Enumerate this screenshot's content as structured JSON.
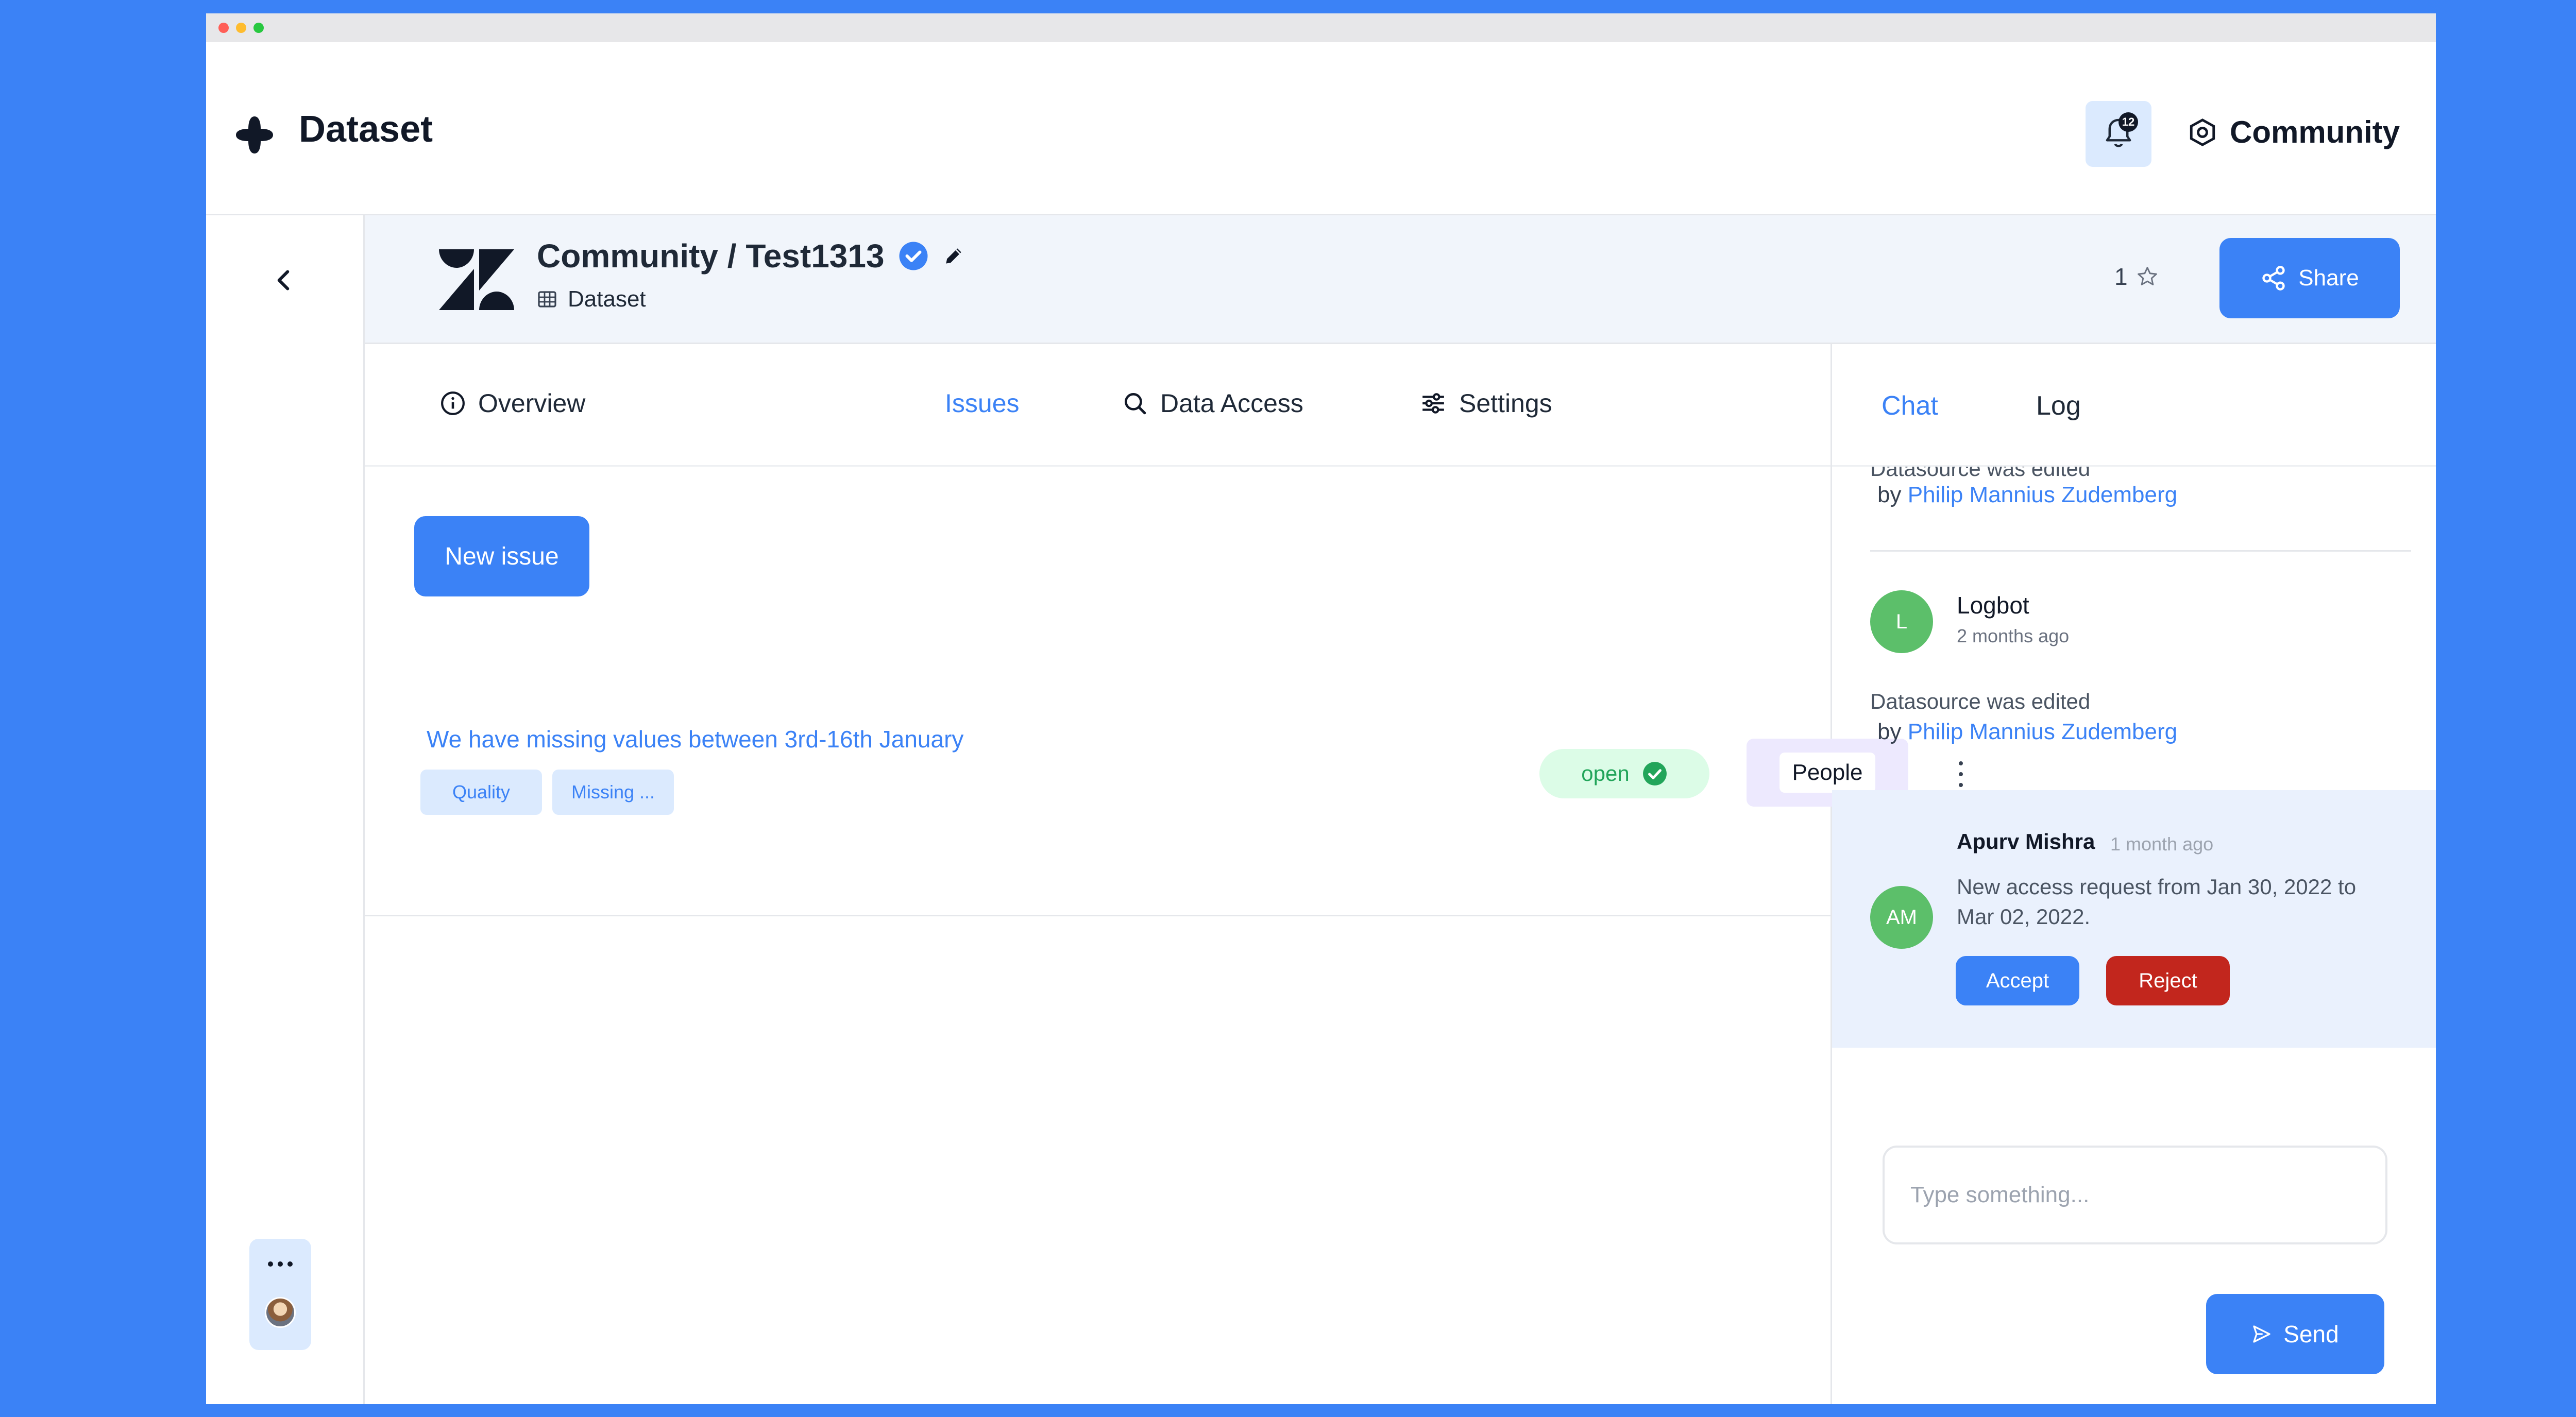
{
  "app": {
    "title": "Dataset",
    "notification_count": "12",
    "workspace": "Community"
  },
  "dataset": {
    "title": "Community / Test1313",
    "type_label": "Dataset",
    "star_count": "1",
    "share_label": "Share"
  },
  "tabs": [
    {
      "label": "Overview",
      "icon": "info-icon"
    },
    {
      "label": "Issues",
      "icon": ""
    },
    {
      "label": "Data Access",
      "icon": "search-icon"
    },
    {
      "label": "Settings",
      "icon": "sliders-icon"
    }
  ],
  "issues": {
    "new_issue_label": "New issue",
    "items": [
      {
        "title": "We have missing values between 3rd-16th January",
        "tags": [
          "Quality",
          "Missing ..."
        ],
        "status": "open",
        "assignee": "People"
      }
    ]
  },
  "panel": {
    "tabs": [
      "Chat",
      "Log"
    ],
    "log_entries": [
      {
        "text": "Datasource was edited",
        "by_prefix": "by",
        "user": "Philip Mannius Zudemberg"
      },
      {
        "avatar": "L",
        "name": "Logbot",
        "time": "2 months ago",
        "text": "Datasource was edited",
        "by_prefix": "by",
        "user": "Philip Mannius Zudemberg"
      }
    ],
    "request": {
      "avatar": "AM",
      "name": "Apurv Mishra",
      "time": "1 month ago",
      "text_line1": "New access request from Jan 30, 2022 to",
      "text_line2": "Mar 02, 2022.",
      "accept_label": "Accept",
      "reject_label": "Reject"
    },
    "input_placeholder": "Type something...",
    "send_label": "Send"
  },
  "colors": {
    "accent": "#3b82f6",
    "success": "#22a55a",
    "danger": "#c2261d",
    "background": "#3b82f6"
  }
}
